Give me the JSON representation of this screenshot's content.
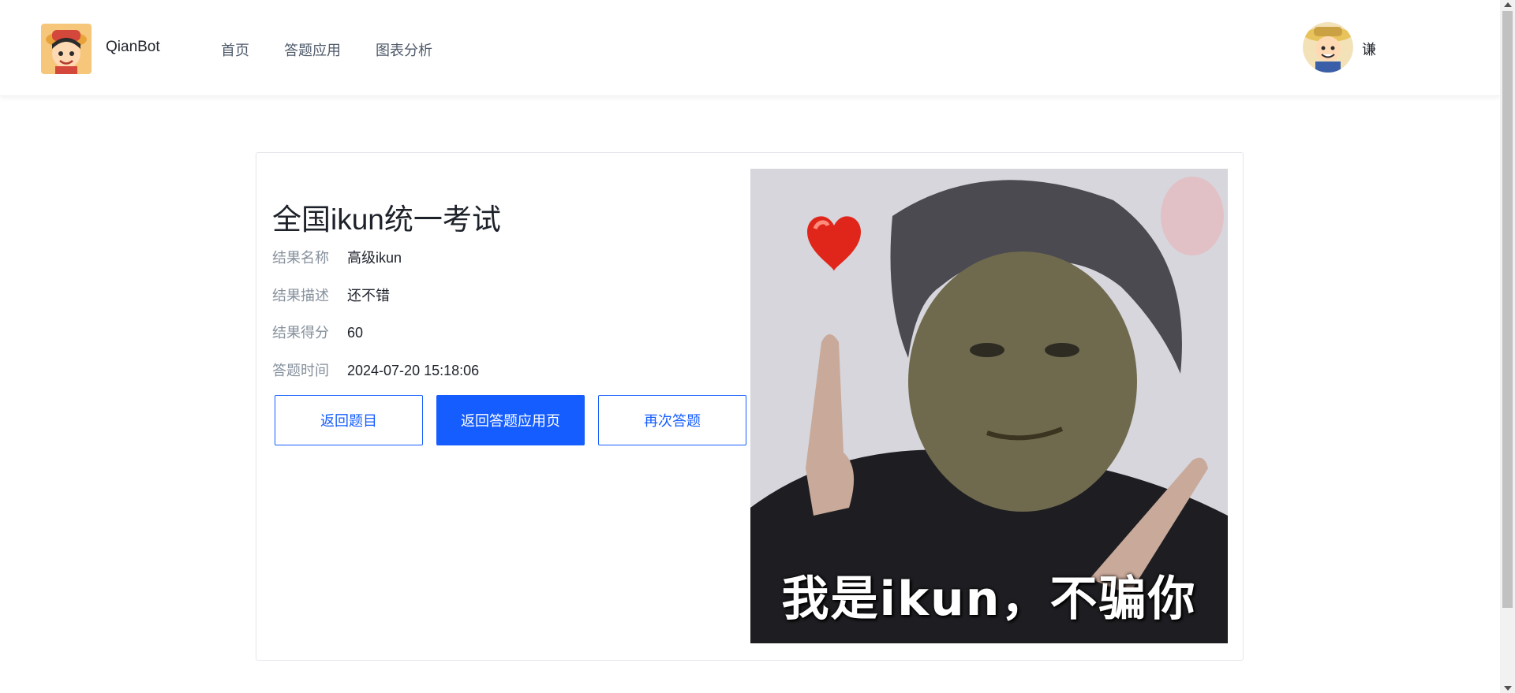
{
  "header": {
    "brand": "QianBot",
    "nav": [
      "首页",
      "答题应用",
      "图表分析"
    ],
    "user_name": "谦"
  },
  "result": {
    "title": "全国ikun统一考试",
    "fields": [
      {
        "label": "结果名称",
        "value": "高级ikun"
      },
      {
        "label": "结果描述",
        "value": "还不错"
      },
      {
        "label": "结果得分",
        "value": "60"
      },
      {
        "label": "答题时间",
        "value": "2024-07-20 15:18:06"
      }
    ],
    "buttons": {
      "back_question": "返回题目",
      "back_app": "返回答题应用页",
      "retry": "再次答题"
    },
    "image_caption": "我是ikun，不骗你"
  },
  "colors": {
    "primary": "#165dff",
    "label": "#86909c",
    "text": "#1d2129"
  }
}
